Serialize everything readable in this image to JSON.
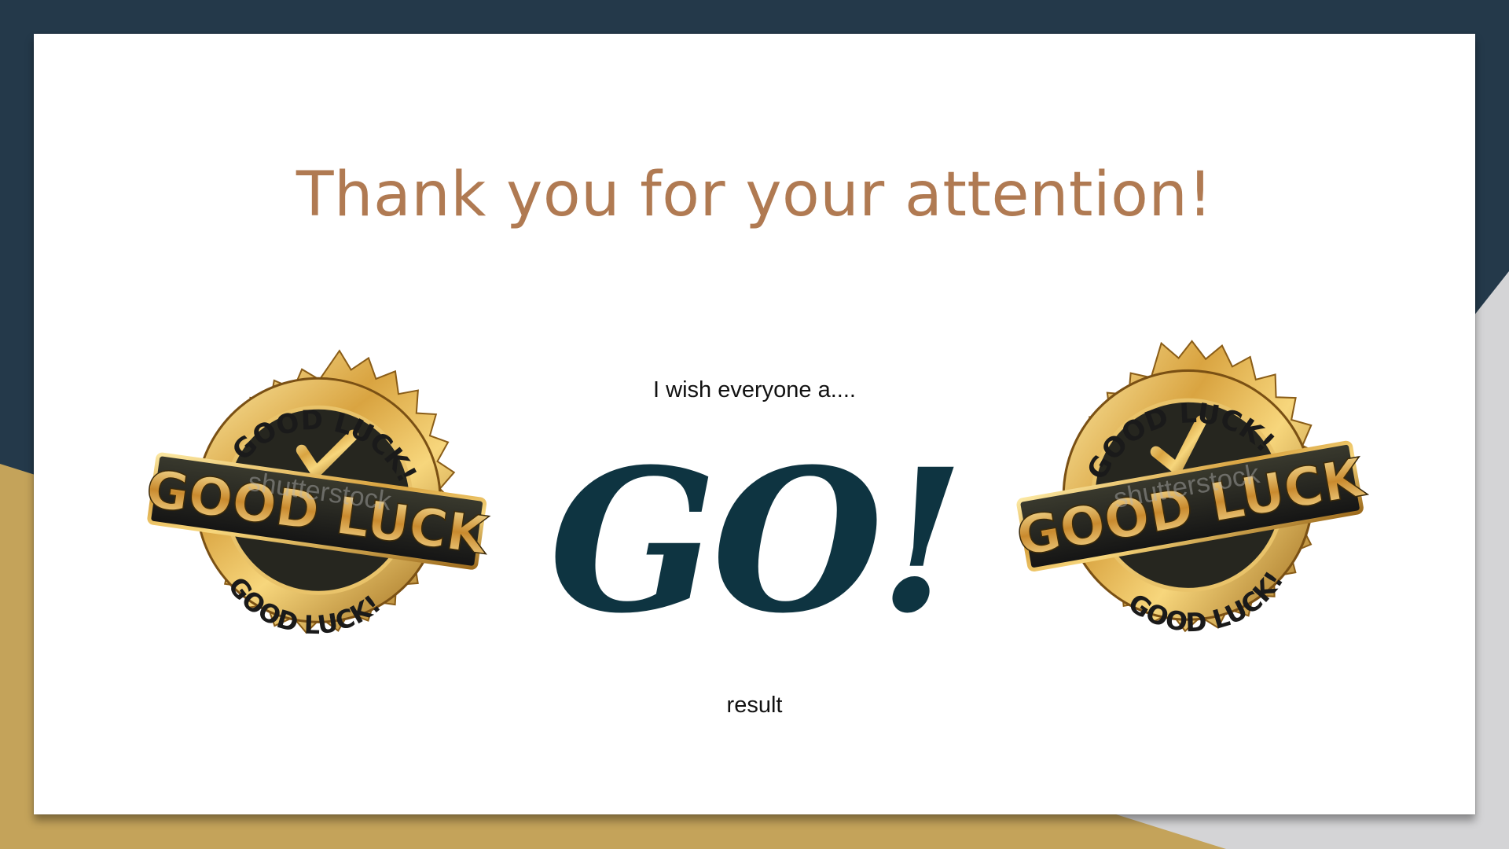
{
  "slide": {
    "title": "Thank you for your attention!",
    "wish": "I wish everyone a....",
    "go": "GO!",
    "result": "result"
  },
  "seal_left": {
    "name": "good-luck-seal",
    "arc_top": "GOOD LUCK!",
    "banner": "GOOD LUCK",
    "arc_bottom": "GOOD LUCK!",
    "watermark": "shutterstock"
  },
  "seal_right": {
    "name": "good-luck-seal",
    "arc_top": "GOOD LUCK!",
    "banner": "GOOD LUCK",
    "arc_bottom": "GOOD LUCK!",
    "watermark": "shutterstock"
  },
  "colors": {
    "navy": "#24394a",
    "gold": "#c4a35a",
    "gray": "#d4d4d6",
    "title": "#b07a52",
    "go": "#0e3441"
  }
}
